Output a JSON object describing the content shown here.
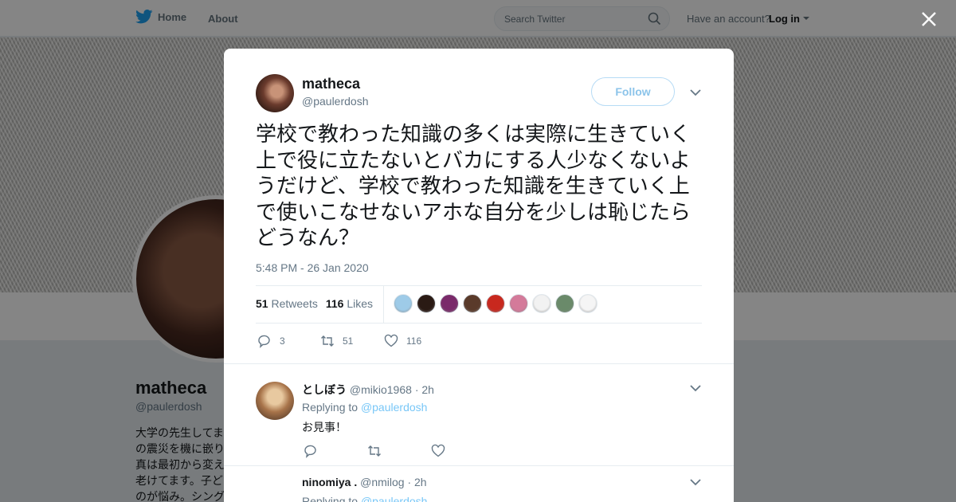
{
  "topbar": {
    "home_label": "Home",
    "about_label": "About",
    "search_placeholder": "Search Twitter",
    "account_text": "Have an account?",
    "login_label": "Log in"
  },
  "profile": {
    "name": "matheca",
    "handle": "@paulerdosh",
    "bio": "大学の先生してま\nの震災を機に嵌り\n真は最初から変え\n老けてます。子ど\nのが悩み。シング"
  },
  "tweet": {
    "author_name": "matheca",
    "author_handle": "@paulerdosh",
    "follow_label": "Follow",
    "text": "学校で教わった知識の多くは実際に生きていく上で役に立たないとバカにする人少なくないようだけど、学校で教わった知識を生きていく上で使いこなせないアホな自分を少しは恥じたらどうなん？",
    "timestamp": "5:48 PM - 26 Jan 2020",
    "retweets_count": "51",
    "retweets_label": "Retweets",
    "likes_count": "116",
    "likes_label": "Likes",
    "action_reply_count": "3",
    "action_retweet_count": "51",
    "action_like_count": "116",
    "liker_colors": [
      "#9ecbe8",
      "#2a1a14",
      "#7a2a6a",
      "#5a3a2a",
      "#c8281e",
      "#d47a9a",
      "#f2f2f2",
      "#6a8a6a",
      "#f5f5f5"
    ]
  },
  "replies": [
    {
      "name": "としぼう",
      "handle": "@mikio1968",
      "time": "· 2h",
      "replying_prefix": "Replying to",
      "replying_handle": "@paulerdosh",
      "text": "お見事！"
    },
    {
      "name": "ninomiya .",
      "handle": "@nmilog",
      "time": "· 2h",
      "replying_prefix": "Replying to",
      "replying_handle": "@paulerdosh"
    }
  ],
  "colors": {
    "accent": "#1da1f2",
    "muted": "#657786",
    "text": "#14171a"
  }
}
